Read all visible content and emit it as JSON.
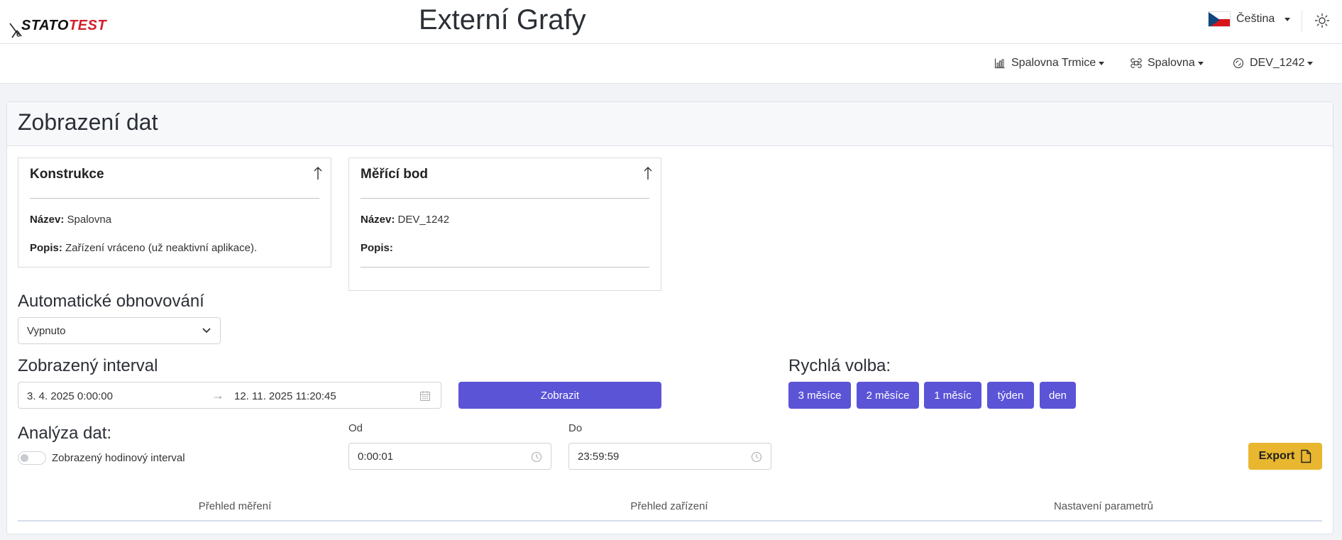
{
  "header": {
    "logo_part1": "STATO",
    "logo_part2": "TEST",
    "title": "Externí Grafy",
    "language": "Čeština"
  },
  "nav": {
    "items": [
      {
        "label": "Spalovna Trmice",
        "icon": "chart-icon"
      },
      {
        "label": "Spalovna",
        "icon": "command-icon"
      },
      {
        "label": "DEV_1242",
        "icon": "device-icon"
      }
    ]
  },
  "page": {
    "title": "Zobrazení dat"
  },
  "construction": {
    "heading": "Konstrukce",
    "name_label": "Název:",
    "name_value": "Spalovna",
    "desc_label": "Popis:",
    "desc_value": "Zařízení vráceno (už neaktivní aplikace)."
  },
  "measuring_point": {
    "heading": "Měřící bod",
    "name_label": "Název:",
    "name_value": "DEV_1242",
    "desc_label": "Popis:",
    "desc_value": ""
  },
  "auto_refresh": {
    "label": "Automatické obnovování",
    "selected": "Vypnuto"
  },
  "interval": {
    "label": "Zobrazený interval",
    "from": "3. 4. 2025 0:00:00",
    "to": "12. 11. 2025 11:20:45",
    "show_button": "Zobrazit"
  },
  "quick": {
    "label": "Rychlá volba:",
    "buttons": [
      "3 měsíce",
      "2 měsíce",
      "1 měsíc",
      "týden",
      "den"
    ]
  },
  "analysis": {
    "label": "Analýza dat:",
    "toggle_label": "Zobrazený hodinový interval",
    "from_label": "Od",
    "from_value": "0:00:01",
    "to_label": "Do",
    "to_value": "23:59:59",
    "export_label": "Export"
  },
  "tabs": [
    "Přehled měření",
    "Přehled zařízení",
    "Nastavení parametrů"
  ],
  "colors": {
    "primary": "#5b54d6",
    "export": "#e9b72f",
    "logo_red": "#d11f2c"
  }
}
